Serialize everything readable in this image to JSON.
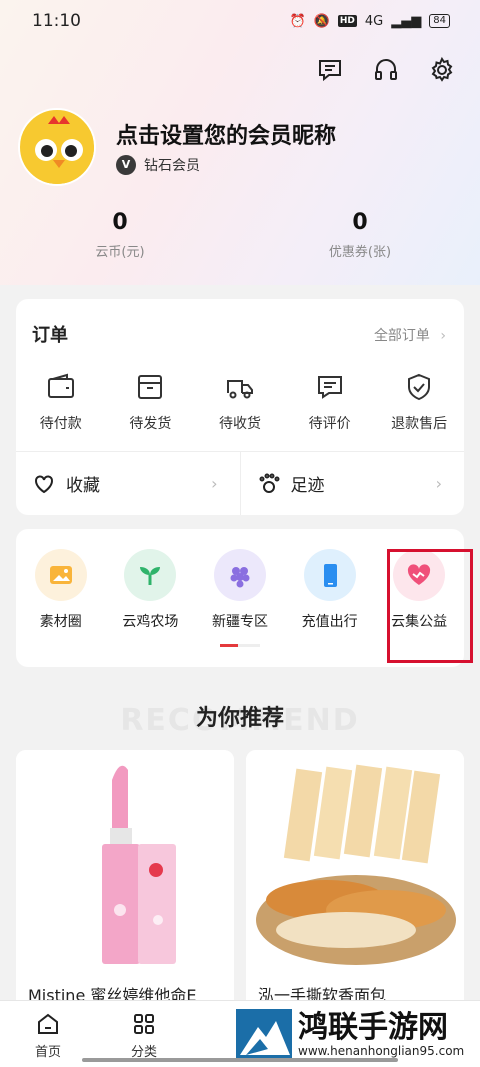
{
  "status_bar": {
    "time": "11:10",
    "network": "4G",
    "hd": "HD",
    "battery": "84"
  },
  "profile": {
    "nickname": "点击设置您的会员昵称",
    "member_level": "钻石会员",
    "member_badge": "V"
  },
  "stats": [
    {
      "value": "0",
      "label": "云币(元)"
    },
    {
      "value": "0",
      "label": "优惠券(张)"
    }
  ],
  "orders": {
    "title": "订单",
    "all_label": "全部订单",
    "items": [
      {
        "label": "待付款",
        "icon": "wallet-icon"
      },
      {
        "label": "待发货",
        "icon": "box-icon"
      },
      {
        "label": "待收货",
        "icon": "truck-icon"
      },
      {
        "label": "待评价",
        "icon": "comment-icon"
      },
      {
        "label": "退款售后",
        "icon": "shield-icon"
      }
    ]
  },
  "quick_links": [
    {
      "label": "收藏",
      "icon": "heart-icon"
    },
    {
      "label": "足迹",
      "icon": "footprint-icon"
    }
  ],
  "services": [
    {
      "label": "素材圈",
      "icon": "image-icon",
      "color": "#f9b43a"
    },
    {
      "label": "云鸡农场",
      "icon": "sprout-icon",
      "color": "#2fb36b"
    },
    {
      "label": "新疆专区",
      "icon": "grape-icon",
      "color": "#8a6fe0"
    },
    {
      "label": "充值出行",
      "icon": "phone-icon",
      "color": "#2a8ef0"
    },
    {
      "label": "云集公益",
      "icon": "charity-heart-icon",
      "color": "#f0507a"
    }
  ],
  "recommend": {
    "title": "为你推荐",
    "bg_text": "RECOMMEND"
  },
  "products": [
    {
      "name": "Mistine 蜜丝婷维他命E"
    },
    {
      "name": "泓一手撕软香面包"
    }
  ],
  "tabbar": [
    {
      "label": "首页",
      "icon": "home-icon"
    },
    {
      "label": "分类",
      "icon": "grid-icon"
    }
  ],
  "watermark": {
    "title": "鸿联手游网",
    "url": "www.henanhonglian95.com"
  },
  "colors": {
    "accent": "#e4393c",
    "highlight_box": "#d6102f"
  }
}
